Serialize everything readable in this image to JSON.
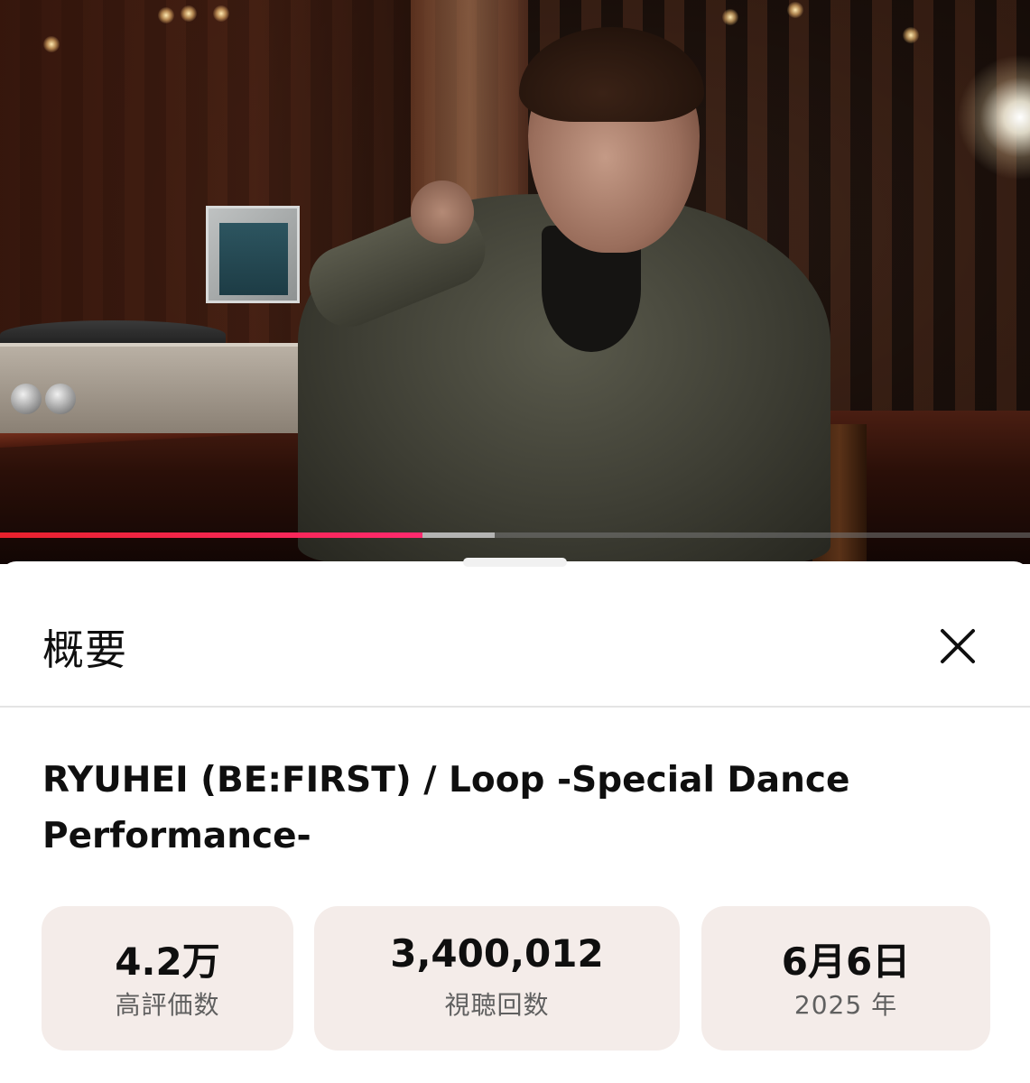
{
  "player": {
    "progress_fraction": 0.41,
    "buffer_fraction": 0.48,
    "progress_color": "#ff2a3a"
  },
  "sheet": {
    "title": "概要",
    "close_icon": "close-x-icon"
  },
  "video": {
    "title": "RYUHEI (BE:FIRST) / Loop -Special Dance Performance-"
  },
  "stats": {
    "likes": {
      "value": "4.2万",
      "label": "高評価数"
    },
    "views": {
      "value": "3,400,012",
      "label": "視聴回数"
    },
    "date": {
      "value": "6月6日",
      "label": "2025 年"
    }
  },
  "colors": {
    "card_background": "#f4ece9",
    "text_primary": "#0f0f0f",
    "text_secondary": "#606060"
  }
}
